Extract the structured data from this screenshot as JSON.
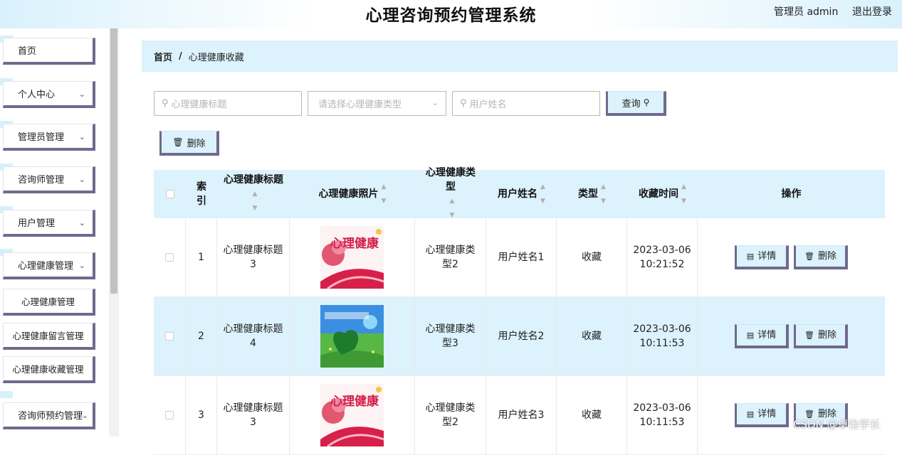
{
  "header": {
    "title": "心理咨询预约管理系统",
    "admin": "管理员 admin",
    "logout": "退出登录"
  },
  "sidebar": {
    "items": [
      {
        "label": "首页"
      },
      {
        "label": "个人中心"
      },
      {
        "label": "管理员管理"
      },
      {
        "label": "咨询师管理"
      },
      {
        "label": "用户管理"
      },
      {
        "label": "心理健康管理"
      },
      {
        "label": "咨询师预约管理"
      }
    ],
    "subitems": [
      {
        "label": "心理健康管理"
      },
      {
        "label": "心理健康留言管理"
      },
      {
        "label": "心理健康收藏管理"
      }
    ]
  },
  "breadcrumb": {
    "home": "首页",
    "sep": "/",
    "current": "心理健康收藏"
  },
  "search": {
    "title_placeholder": "心理健康标题",
    "type_placeholder": "请选择心理健康类型",
    "user_placeholder": "用户姓名",
    "query_label": "查询",
    "delete_label": "删除"
  },
  "table": {
    "headers": {
      "index": "索引",
      "title": "心理健康标题",
      "photo": "心理健康照片",
      "type": "心理健康类型",
      "user": "用户姓名",
      "kind": "类型",
      "time": "收藏时间",
      "ops": "操作"
    },
    "rows": [
      {
        "index": "1",
        "title": "心理健康标题3",
        "type": "心理健康类型2",
        "user": "用户姓名1",
        "kind": "收藏",
        "date": "2023-03-06",
        "clock": "10:21:52"
      },
      {
        "index": "2",
        "title": "心理健康标题4",
        "type": "心理健康类型3",
        "user": "用户姓名2",
        "kind": "收藏",
        "date": "2023-03-06",
        "clock": "10:11:53"
      },
      {
        "index": "3",
        "title": "心理健康标题3",
        "type": "心理健康类型2",
        "user": "用户姓名3",
        "kind": "收藏",
        "date": "2023-03-06",
        "clock": "10:11:53"
      }
    ],
    "detail_label": "详情",
    "delete_label": "删除"
  },
  "watermark": "CSDN @卓怡学长",
  "colors": {
    "accent": "#dcf2fc",
    "border": "#6e6a8e"
  }
}
